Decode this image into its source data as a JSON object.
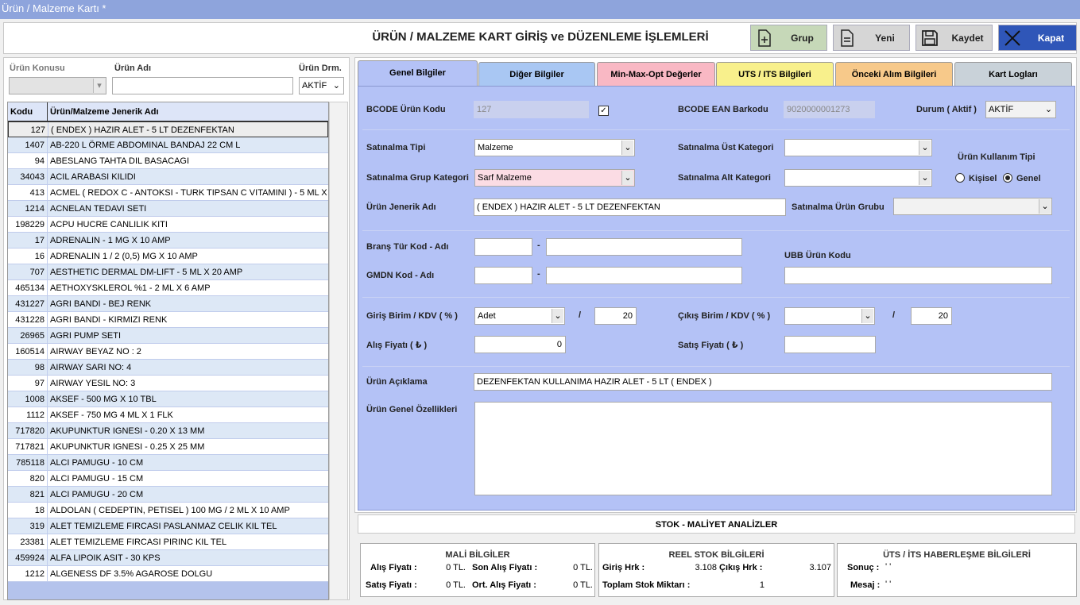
{
  "window": {
    "title": "Ürün / Malzeme Kartı *"
  },
  "header": {
    "title": "ÜRÜN / MALZEME KART GİRİŞ ve DÜZENLEME İŞLEMLERİ"
  },
  "toolbar": {
    "grup": "Grup",
    "yeni": "Yeni",
    "kaydet": "Kaydet",
    "kapat": "Kapat",
    "colors": {
      "grup": "#c6d8b8",
      "kapat": "#2f56b8"
    }
  },
  "filter": {
    "konu_label": "Ürün Konusu",
    "adi_label": "Ürün Adı",
    "durum_label": "Ürün Drm.",
    "durum_value": "AKTİF"
  },
  "grid": {
    "headers": [
      "Kodu",
      "Ürün/Malzeme Jenerik Adı"
    ],
    "rows": [
      [
        "127",
        "( ENDEX ) HAZIR ALET - 5 LT DEZENFEKTAN"
      ],
      [
        "1407",
        "AB-220 L  ÖRME ABDOMINAL BANDAJ 22 CM L"
      ],
      [
        "94",
        "ABESLANG TAHTA DIL BASACAGI"
      ],
      [
        "34043",
        "ACIL ARABASI KILIDI"
      ],
      [
        "413",
        "ACMEL ( REDOX C - ANTOKSI -  TURK TIPSAN C VITAMINI ) - 5 ML X"
      ],
      [
        "1214",
        "ACNELAN TEDAVI SETI"
      ],
      [
        "198229",
        "ACPU HUCRE CANLILIK KITI"
      ],
      [
        "17",
        "ADRENALIN - 1 MG X 10 AMP"
      ],
      [
        "16",
        "ADRENALIN 1 / 2 (0,5) MG X 10 AMP"
      ],
      [
        "707",
        "AESTHETIC DERMAL DM-LIFT - 5 ML X 20 AMP"
      ],
      [
        "465134",
        "AETHOXYSKLEROL %1 - 2 ML X 6 AMP"
      ],
      [
        "431227",
        "AGRI BANDI - BEJ RENK"
      ],
      [
        "431228",
        "AGRI BANDI - KIRMIZI RENK"
      ],
      [
        "26965",
        "AGRI PUMP SETI"
      ],
      [
        "160514",
        "AIRWAY BEYAZ NO : 2"
      ],
      [
        "98",
        "AIRWAY SARI NO: 4"
      ],
      [
        "97",
        "AIRWAY YESIL NO: 3"
      ],
      [
        "1008",
        "AKSEF - 500 MG X  10 TBL"
      ],
      [
        "1112",
        "AKSEF - 750 MG 4 ML X 1 FLK"
      ],
      [
        "717820",
        "AKUPUNKTUR IGNESI - 0.20 X 13 MM"
      ],
      [
        "717821",
        "AKUPUNKTUR IGNESI - 0.25 X 25 MM"
      ],
      [
        "785118",
        "ALCI PAMUGU - 10 CM"
      ],
      [
        "820",
        "ALCI PAMUGU - 15 CM"
      ],
      [
        "821",
        "ALCI PAMUGU - 20 CM"
      ],
      [
        "18",
        "ALDOLAN ( CEDEPTIN, PETISEL ) 100 MG / 2 ML X 10  AMP"
      ],
      [
        "319",
        "ALET TEMIZLEME FIRCASI PASLANMAZ CELIK KIL TEL"
      ],
      [
        "23381",
        "ALET TEMIZLEME FIRCASI PIRINC KIL TEL"
      ],
      [
        "459924",
        "ALFA LIPOIK ASIT - 30 KPS"
      ],
      [
        "1212",
        "ALGENESS DF 3.5% AGAROSE  DOLGU"
      ]
    ]
  },
  "tabs": [
    {
      "label": "Genel Bilgiler",
      "color": "#b4c2f6"
    },
    {
      "label": "Diğer Bilgiler",
      "color": "#a9c7f3"
    },
    {
      "label": "Min-Max-Opt Değerler",
      "color": "#f9b8c4"
    },
    {
      "label": "UTS / ITS Bilgileri",
      "color": "#f8f08c"
    },
    {
      "label": "Önceki Alım Bilgileri",
      "color": "#f7c98a"
    },
    {
      "label": "Kart Logları",
      "color": "#c9d2d9"
    }
  ],
  "form": {
    "bcode_urun_kodu_label": "BCODE Ürün Kodu",
    "bcode_urun_kodu": "127",
    "bcode_ean_label": "BCODE EAN Barkodu",
    "bcode_ean": "9020000001273",
    "durum_label": "Durum ( Aktif )",
    "durum": "AKTİF",
    "satinalma_tipi_label": "Satınalma Tipi",
    "satinalma_tipi": "Malzeme",
    "ust_kategori_label": "Satınalma Üst Kategori",
    "ust_kategori": "",
    "kullanim_tipi_label": "Ürün Kullanım Tipi",
    "grup_kategori_label": "Satınalma Grup Kategori",
    "grup_kategori": "Sarf Malzeme",
    "alt_kategori_label": "Satınalma Alt Kategori",
    "alt_kategori": "",
    "kisisel_label": "Kişisel",
    "genel_label": "Genel",
    "jenerik_label": "Ürün Jenerik Adı",
    "jenerik": "( ENDEX ) HAZIR ALET - 5 LT DEZENFEKTAN",
    "urun_grubu_label": "Satınalma Ürün Grubu",
    "urun_grubu": "",
    "brans_label": "Branş Tür Kod - Adı",
    "gmdn_label": "GMDN Kod - Adı",
    "ubb_label": "UBB Ürün Kodu",
    "dash": "-",
    "slash": "/",
    "giris_birim_label": "Giriş Birim / KDV ( % )",
    "giris_birim": "Adet",
    "giris_kdv": "20",
    "cikis_birim_label": "Çıkış Birim / KDV ( % )",
    "cikis_birim": "",
    "cikis_kdv": "20",
    "alis_fiyati_label": "Alış Fiyatı  ( ₺ )",
    "alis_fiyati": "0",
    "satis_fiyati_label": "Satış Fiyatı  ( ₺ )",
    "satis_fiyati": "",
    "aciklama_label": "Ürün Açıklama",
    "aciklama": "DEZENFEKTAN KULLANIMA HAZIR ALET - 5 LT ( ENDEX )",
    "ozellikler_label": "Ürün Genel Özellikleri",
    "ozellikler": ""
  },
  "stok": {
    "title": "STOK - MALİYET ANALİZLER",
    "mali": {
      "title": "MALİ BİLGİLER",
      "alis_l": "Alış Fiyatı :",
      "alis_v": "0 TL.",
      "son_alis_l": "Son Alış Fiyatı :",
      "son_alis_v": "0 TL.",
      "satis_l": "Satış Fiyatı :",
      "satis_v": "0 TL.",
      "ort_alis_l": "Ort. Alış Fiyatı :",
      "ort_alis_v": "0 TL."
    },
    "reel": {
      "title": "REEL STOK BİLGİLERİ",
      "giris_l": "Giriş Hrk :",
      "giris_v": "3.108",
      "cikis_l": "Çıkış Hrk :",
      "cikis_v": "3.107",
      "toplam_l": "Toplam Stok Miktarı :",
      "toplam_v": "1"
    },
    "uts": {
      "title": "ÜTS / İTS HABERLEŞME BİLGİLERİ",
      "sonuc_l": "Sonuç :",
      "sonuc_v": "' '",
      "mesaj_l": "Mesaj :",
      "mesaj_v": "' '"
    }
  }
}
